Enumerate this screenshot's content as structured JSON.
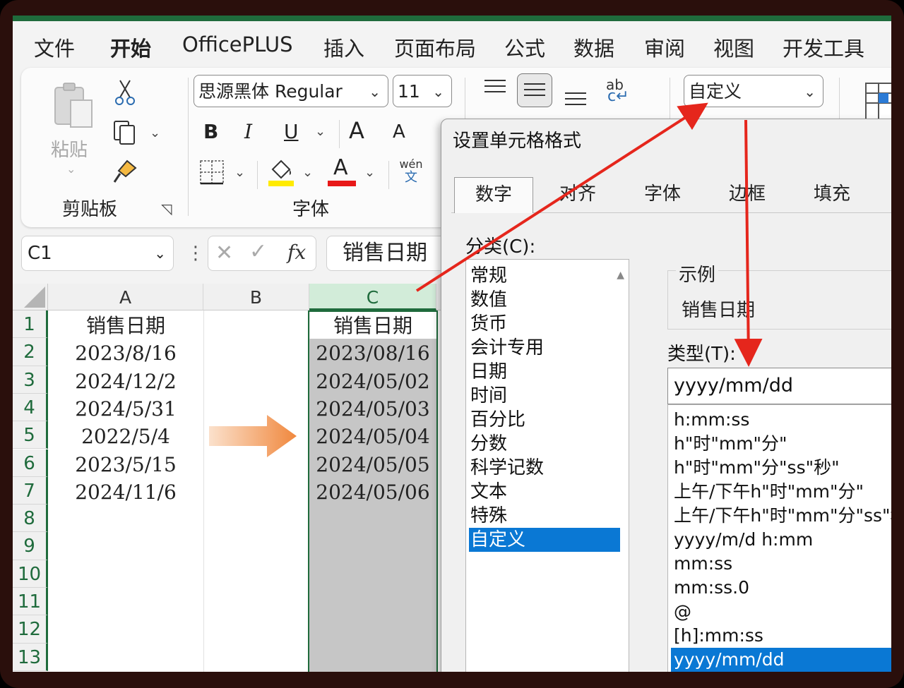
{
  "menu": {
    "tabs": [
      "文件",
      "开始",
      "OfficePLUS",
      "插入",
      "页面布局",
      "公式",
      "数据",
      "审阅",
      "视图",
      "开发工具"
    ]
  },
  "ribbon": {
    "clipboard": {
      "paste_label": "粘贴",
      "group_label": "剪贴板"
    },
    "font": {
      "font_name": "思源黑体 Regular",
      "font_size": "11",
      "group_label": "字体",
      "bold": "B",
      "italic": "I",
      "underline": "U",
      "grow": "A",
      "shrink": "A",
      "font_color": "A",
      "phonetic_top": "wén",
      "phonetic_bottom": "文"
    },
    "number_format": "自定义",
    "wrap_icon": "ab"
  },
  "formula_bar": {
    "name_box": "C1",
    "fx": "fx",
    "content": "销售日期"
  },
  "sheet": {
    "columns": [
      "A",
      "B",
      "C"
    ],
    "rows": [
      "1",
      "2",
      "3",
      "4",
      "5",
      "6",
      "7",
      "8",
      "9",
      "10",
      "11",
      "12",
      "13"
    ],
    "col_a": [
      "销售日期",
      "2023/8/16",
      "2024/12/2",
      "2024/5/31",
      "2022/5/4",
      "2023/5/15",
      "2024/11/6"
    ],
    "col_c": [
      "销售日期",
      "2023/08/16",
      "2024/05/02",
      "2024/05/03",
      "2024/05/04",
      "2024/05/05",
      "2024/05/06"
    ]
  },
  "dialog": {
    "title": "设置单元格格式",
    "tabs": [
      "数字",
      "对齐",
      "字体",
      "边框",
      "填充"
    ],
    "category_label": "分类(C):",
    "categories": [
      "常规",
      "数值",
      "货币",
      "会计专用",
      "日期",
      "时间",
      "百分比",
      "分数",
      "科学记数",
      "文本",
      "特殊",
      "自定义"
    ],
    "selected_category": "自定义",
    "sample_label": "示例",
    "sample_value": "销售日期",
    "type_label": "类型(T):",
    "type_value": "yyyy/mm/dd",
    "formats": [
      "h:mm:ss",
      "h\"时\"mm\"分\"",
      "h\"时\"mm\"分\"ss\"秒\"",
      "上午/下午h\"时\"mm\"分\"",
      "上午/下午h\"时\"mm\"分\"ss\"秒\"",
      "yyyy/m/d h:mm",
      "mm:ss",
      "mm:ss.0",
      "@",
      "[h]:mm:ss",
      "yyyy/mm/dd"
    ],
    "selected_format": "yyyy/mm/dd"
  },
  "colors": {
    "excel_green": "#1f6b3c",
    "selection_blue": "#0a78d4",
    "annotation_red": "#e5261c",
    "arrow_orange": "#f0a060"
  }
}
